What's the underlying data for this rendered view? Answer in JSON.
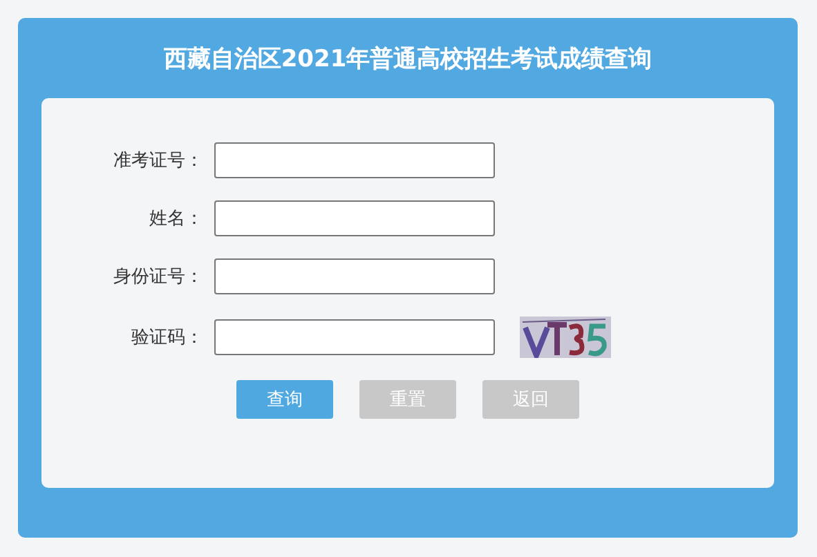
{
  "title": "西藏自治区2021年普通高校招生考试成绩查询",
  "fields": [
    {
      "label": "准考证号："
    },
    {
      "label": "姓名："
    },
    {
      "label": "身份证号："
    },
    {
      "label": "验证码：",
      "kind": "captcha"
    }
  ],
  "buttons": [
    {
      "label": "查询",
      "kind": "primary"
    },
    {
      "label": "重置",
      "kind": "secondary"
    },
    {
      "label": "返回",
      "kind": "secondary"
    }
  ]
}
